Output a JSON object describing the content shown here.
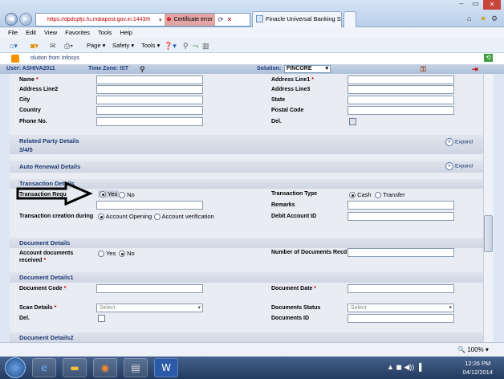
{
  "browser": {
    "url": "https://dpdcpfjc.fu.indiapost.gov.in:1443/fi",
    "cert_error": "Certificate error",
    "tab_title": "Finacle Universal Banking S...",
    "menu": [
      "File",
      "Edit",
      "View",
      "Favorites",
      "Tools",
      "Help"
    ],
    "cmd": {
      "page": "Page",
      "safety": "Safety",
      "tools": "Tools"
    }
  },
  "app": {
    "brand": "olution from Infosys",
    "user": "User: ASHIVA2011",
    "timezone": "Time Zone: IST",
    "solution_label": "Solution:",
    "solution_value": "FINCORE"
  },
  "address_form": {
    "name": "Name",
    "address_line1": "Address Line1",
    "address_line2": "Address Line2",
    "address_line3": "Address Line3",
    "city": "City",
    "state": "State",
    "country": "Country",
    "postal_code": "Postal Code",
    "phone": "Phone No.",
    "del": "Del."
  },
  "sections": {
    "related_party": "Related Party Details",
    "related_party_sub": "3/4/5",
    "auto_renewal": "Auto Renewal Details",
    "transaction": "Transaction Details",
    "document": "Document Details",
    "document1": "Document Details1",
    "document2": "Document Details2",
    "expand": "Expand"
  },
  "transaction": {
    "tran_required": "Transaction Requ",
    "tran_type": "Transaction Type",
    "remarks": "Remarks",
    "creation_during": "Transaction creation during",
    "debit_account": "Debit Account ID",
    "yes": "Yes",
    "no": "No",
    "cash": "Cash",
    "transfer": "Transfer",
    "account_opening": "Account Opening",
    "account_verification": "Account verification"
  },
  "document": {
    "received_label": "Account documents received",
    "yes": "Yes",
    "no": "No",
    "num_docs": "Number of Documents Recd"
  },
  "document1": {
    "doc_code": "Document Code",
    "doc_date": "Document Date",
    "scan_details": "Scan Details",
    "doc_status": "Documents Status",
    "del": "Del.",
    "doc_id": "Documents ID",
    "select": "Select"
  },
  "status": {
    "zoom": "100%"
  },
  "clock": {
    "time": "12:26 PM",
    "date": "04/12/2014"
  }
}
